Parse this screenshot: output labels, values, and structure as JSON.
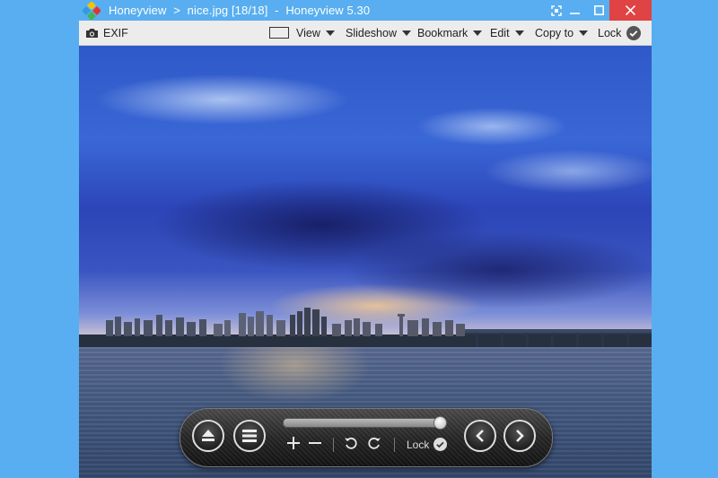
{
  "window": {
    "app_name": "Honeyview",
    "separator": ">",
    "file_name": "nice.jpg",
    "position": "[18/18]",
    "dash": "-",
    "app_version": "Honeyview 5.30"
  },
  "toolbar": {
    "exif_label": "EXIF",
    "view_label": "View",
    "slideshow_label": "Slideshow",
    "bookmark_label": "Bookmark",
    "edit_label": "Edit",
    "copy_label": "Copy to",
    "lock_label": "Lock"
  },
  "controls": {
    "lock_label": "Lock",
    "seek_progress": 0.97
  },
  "colors": {
    "titlebar": "#58aef0",
    "close_button": "#e04343",
    "toolbar": "#ececec"
  },
  "icons": [
    "app-logo-icon",
    "special-icon",
    "minimize-icon",
    "maximize-icon",
    "close-icon",
    "camera-icon",
    "view-box-icon",
    "chevron-down-icon",
    "check-circle-icon",
    "eject-icon",
    "menu-icon",
    "zoom-in-icon",
    "zoom-out-icon",
    "rotate-left-icon",
    "rotate-right-icon",
    "previous-icon",
    "next-icon"
  ]
}
